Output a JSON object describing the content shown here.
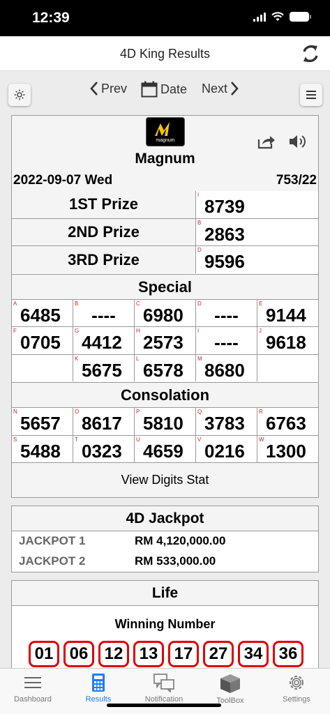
{
  "status": {
    "time": "12:39"
  },
  "nav": {
    "title": "4D King Results"
  },
  "toolbar": {
    "prev": "Prev",
    "date": "Date",
    "next": "Next"
  },
  "draw": {
    "operator": "Magnum",
    "logo_text": "magnum",
    "date": "2022-09-07 Wed",
    "draw_no": "753/22",
    "prizes": [
      {
        "label": "1ST Prize",
        "letter": "I",
        "number": "8739"
      },
      {
        "label": "2ND Prize",
        "letter": "B",
        "number": "2863"
      },
      {
        "label": "3RD Prize",
        "letter": "D",
        "number": "9596"
      }
    ],
    "special_title": "Special",
    "special": [
      {
        "letter": "A",
        "number": "6485"
      },
      {
        "letter": "B",
        "number": "----"
      },
      {
        "letter": "C",
        "number": "6980"
      },
      {
        "letter": "D",
        "number": "----"
      },
      {
        "letter": "E",
        "number": "9144"
      },
      {
        "letter": "F",
        "number": "0705"
      },
      {
        "letter": "G",
        "number": "4412"
      },
      {
        "letter": "H",
        "number": "2573"
      },
      {
        "letter": "I",
        "number": "----"
      },
      {
        "letter": "J",
        "number": "9618"
      },
      {
        "letter": "",
        "number": ""
      },
      {
        "letter": "K",
        "number": "5675"
      },
      {
        "letter": "L",
        "number": "6578"
      },
      {
        "letter": "M",
        "number": "8680"
      },
      {
        "letter": "",
        "number": ""
      }
    ],
    "consolation_title": "Consolation",
    "consolation": [
      {
        "letter": "N",
        "number": "5657"
      },
      {
        "letter": "O",
        "number": "8617"
      },
      {
        "letter": "P",
        "number": "5810"
      },
      {
        "letter": "Q",
        "number": "3783"
      },
      {
        "letter": "R",
        "number": "6763"
      },
      {
        "letter": "S",
        "number": "5488"
      },
      {
        "letter": "T",
        "number": "0323"
      },
      {
        "letter": "U",
        "number": "4659"
      },
      {
        "letter": "V",
        "number": "0216"
      },
      {
        "letter": "W",
        "number": "1300"
      }
    ],
    "view_stat": "View Digits Stat"
  },
  "jackpot": {
    "title": "4D Jackpot",
    "rows": [
      {
        "label": "JACKPOT 1",
        "amount": "RM 4,120,000.00"
      },
      {
        "label": "JACKPOT 2",
        "amount": "RM 533,000.00"
      }
    ]
  },
  "life": {
    "title": "Life",
    "subtitle": "Winning Number",
    "numbers": [
      "01",
      "06",
      "12",
      "13",
      "17",
      "27",
      "34",
      "36"
    ]
  },
  "tabs": [
    {
      "label": "Dashboard",
      "icon": "menu-icon",
      "active": false
    },
    {
      "label": "Results",
      "icon": "calculator-icon",
      "active": true
    },
    {
      "label": "Notification",
      "icon": "chat-icon",
      "active": false
    },
    {
      "label": "ToolBox",
      "icon": "box-icon",
      "active": false
    },
    {
      "label": "Settings",
      "icon": "gear-icon",
      "active": false
    }
  ],
  "colors": {
    "accent": "#1e7ef0",
    "ball_border": "#e00000",
    "letter": "#e02020"
  }
}
